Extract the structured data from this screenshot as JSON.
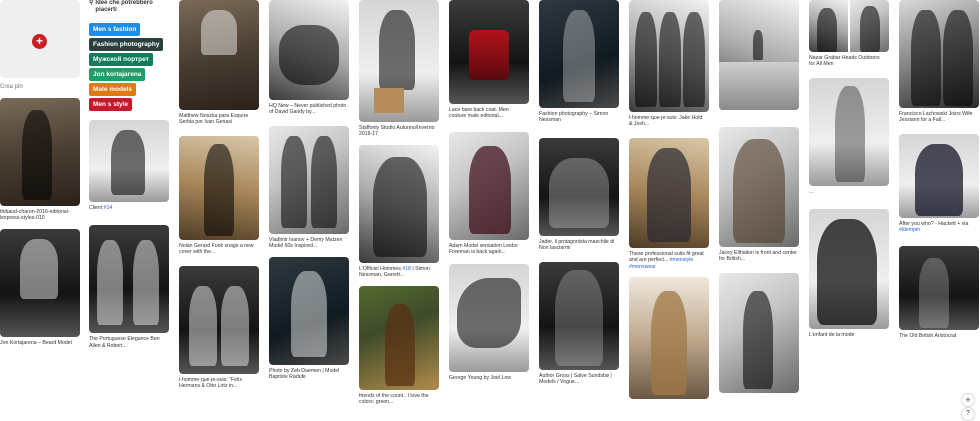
{
  "create": {
    "label": "Crea pin",
    "plus": "+"
  },
  "ideas": {
    "heading": "Idee che potrebbero piacerti",
    "icon": "search-icon",
    "tags": [
      {
        "label": "Men s fashion",
        "color": "#1e8de6"
      },
      {
        "label": "Fashion photography",
        "color": "#2b3f3c"
      },
      {
        "label": "Мужской портрет",
        "color": "#127c5c"
      },
      {
        "label": "Jon kortajarena",
        "color": "#1f9d6a"
      },
      {
        "label": "Male models",
        "color": "#e07a10"
      },
      {
        "label": "Men s style",
        "color": "#c8182b"
      }
    ]
  },
  "captions": {
    "c1a": "thibaud-charon-2016-editorial-lexpress-styles-010",
    "c1b": "Jon Kortajarena – Beard Model",
    "c2a_pre": "Client ",
    "c2a_hl": "#14",
    "c2b": "The Portuguese Elegance Ben Allen & Robert...",
    "c3a": "Matthew Noszka para Esquire Serbia por Ivan Genasi",
    "c3b": "Nolan Gerard Funk snags a new cover with the...",
    "c3c": "l-homme-que-je-suis: \"Felix Hermans & Otto Lotz in...",
    "c4a": "HQ New – Never published photo of David Gandy by...",
    "c4b": "Vladimir Ivanov + Demy Matzen Model 60s Inspired...",
    "c4c": "Photo by Zeb Daemen | Model Baptiste Radufe",
    "c5a": "Staffonly Studio Autunno/Inverno 2016-17",
    "c5b_pre": "L'Officiel Hommes ",
    "c5b_hl": "#18",
    "c5b_post": " | Simon Nessman, Garrett...",
    "c5c": "friends of the count.. I love the colors: green...",
    "c6a": "Lace bare back coat. Men couture male editorial...",
    "c6b": "Adam Model sensation Leebo Freeman is back again...",
    "c6c": "George Young by Joel Low",
    "c7a": "Fashion photography – Simon Nessman",
    "c7b": "Jader, il protagonista maschile di Non lasciarmi",
    "c7c": "Author Gross | Salve Sundsbø | Models / Vogue...",
    "c8a": "l-homme-que-je-suis: Jake Hold & Josh...",
    "c8b_pre": "These professional suits fit great and are perfect... ",
    "c8b_hl": "#menstyle #menswear",
    "c9b": "Jacey Elthalion is front and center for British...",
    "c10a": "Nazar Grabar Heads Outdoors for All Men",
    "c10b": "...",
    "c10c": "L'enfant de la mode",
    "c11a": "Francisco Lachowski Joins Wife Jessiann for a Fall...",
    "c11b_pre": "After you who? - Hackett + via ",
    "c11b_hl": "#idempin",
    "c11c": "The Old British Aristocrat"
  },
  "fab": {
    "plus": "+",
    "help": "?"
  }
}
